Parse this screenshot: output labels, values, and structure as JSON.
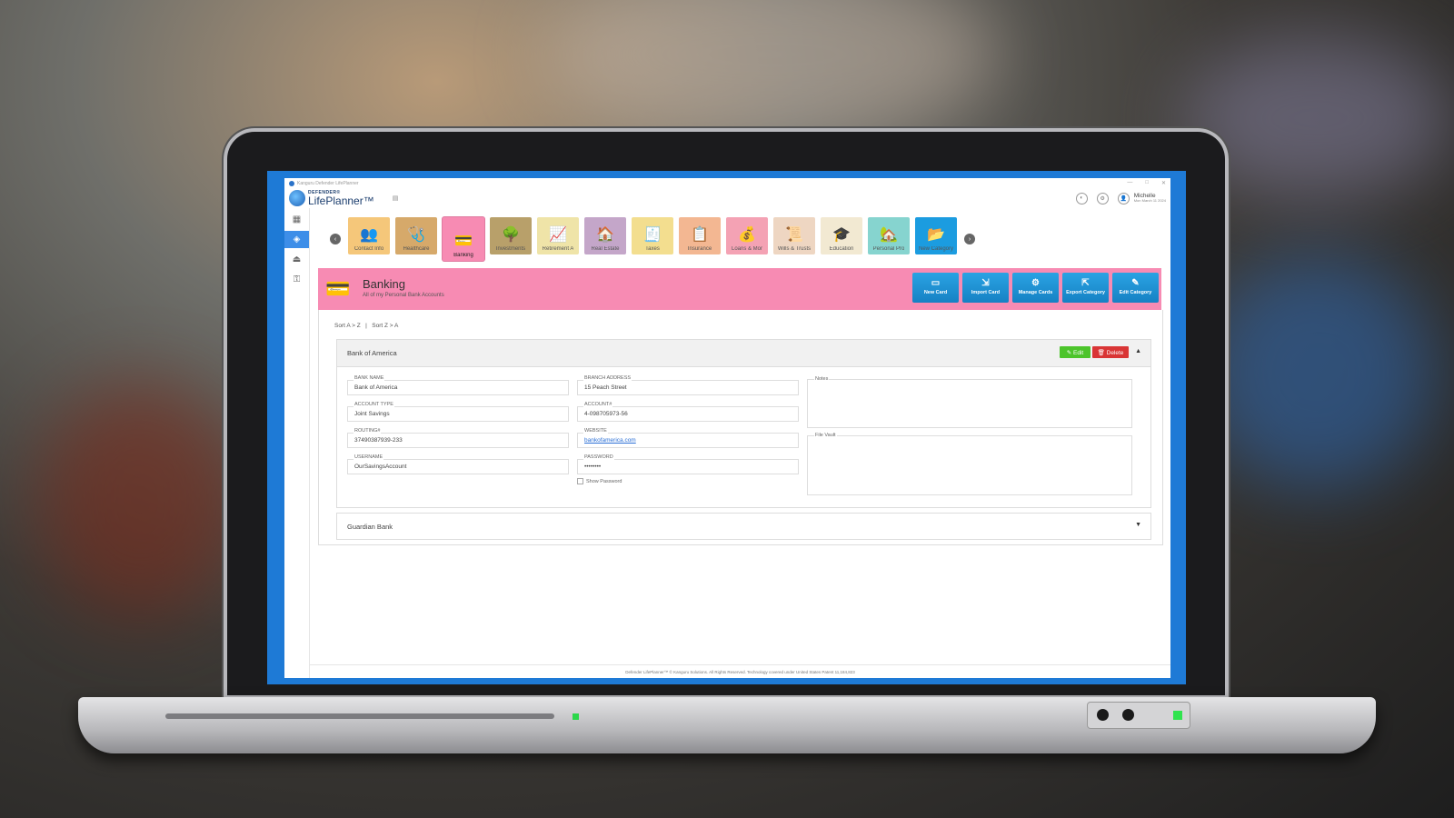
{
  "window": {
    "title": "Kanguru Defender LifePlanner",
    "controls": [
      "—",
      "□",
      "✕"
    ]
  },
  "brand": {
    "top": "DEFENDER®",
    "main": "LifePlanner™"
  },
  "user": {
    "name": "Michelle",
    "date": "Mon March 11 2024"
  },
  "categories": [
    {
      "label": "Contact Info",
      "icon": "👥",
      "color": "#f5c77a"
    },
    {
      "label": "Healthcare",
      "icon": "🩺",
      "color": "#d6a96a"
    },
    {
      "label": "Banking",
      "icon": "💳",
      "color": "#f78bb3"
    },
    {
      "label": "Investments",
      "icon": "🌳",
      "color": "#b8a06a"
    },
    {
      "label": "Retirement A",
      "icon": "📈",
      "color": "#efe4a8"
    },
    {
      "label": "Real Estate",
      "icon": "🏠",
      "color": "#c4a6c9"
    },
    {
      "label": "Taxes",
      "icon": "🧾",
      "color": "#f3de8f"
    },
    {
      "label": "Insurance",
      "icon": "📋",
      "color": "#f3b792"
    },
    {
      "label": "Loans & Mor",
      "icon": "💰",
      "color": "#f4a2b4"
    },
    {
      "label": "Wills & Trusts",
      "icon": "📜",
      "color": "#eed6c2"
    },
    {
      "label": "Education",
      "icon": "🎓",
      "color": "#f2e9d2"
    },
    {
      "label": "Personal Pro",
      "icon": "🏡",
      "color": "#86d4cf"
    },
    {
      "label": "New Category",
      "icon": "📂",
      "color": "#1b9ce0"
    }
  ],
  "header": {
    "title": "Banking",
    "subtitle": "All of my Personal Bank Accounts"
  },
  "actions": [
    {
      "label": "New Card",
      "icon": "▭"
    },
    {
      "label": "Import Card",
      "icon": "⇲"
    },
    {
      "label": "Manage Cards",
      "icon": "⚙"
    },
    {
      "label": "Export Category",
      "icon": "⇱"
    },
    {
      "label": "Edit Category",
      "icon": "✎"
    }
  ],
  "sort": {
    "az": "Sort A > Z",
    "sep": "|",
    "za": "Sort Z > A"
  },
  "card": {
    "title": "Bank of America",
    "edit_label": "✎ Edit",
    "delete_label": "🗑 Delete",
    "fields": {
      "bank_name": {
        "label": "BANK NAME",
        "value": "Bank of America"
      },
      "account_type": {
        "label": "ACCOUNT TYPE",
        "value": "Joint Savings"
      },
      "routing": {
        "label": "ROUTING#",
        "value": "37490387939-233"
      },
      "username": {
        "label": "USERNAME",
        "value": "OurSavingsAccount"
      },
      "branch_address": {
        "label": "BRANCH ADDRESS",
        "value": "15 Peach Street"
      },
      "account": {
        "label": "ACCOUNT#",
        "value": "4-098705973-56"
      },
      "website": {
        "label": "WEBSITE",
        "value": "bankofamerica.com"
      },
      "password": {
        "label": "PASSWORD",
        "value": "••••••••"
      }
    },
    "show_password": "Show Password",
    "notes_label": "Notes",
    "file_vault_label": "File Vault"
  },
  "card2": {
    "title": "Guardian Bank"
  },
  "footer": "Defender LifePlanner™ © Kanguru Solutions. All Rights Reserved. Technology covered under United States Patent 11,184,823"
}
